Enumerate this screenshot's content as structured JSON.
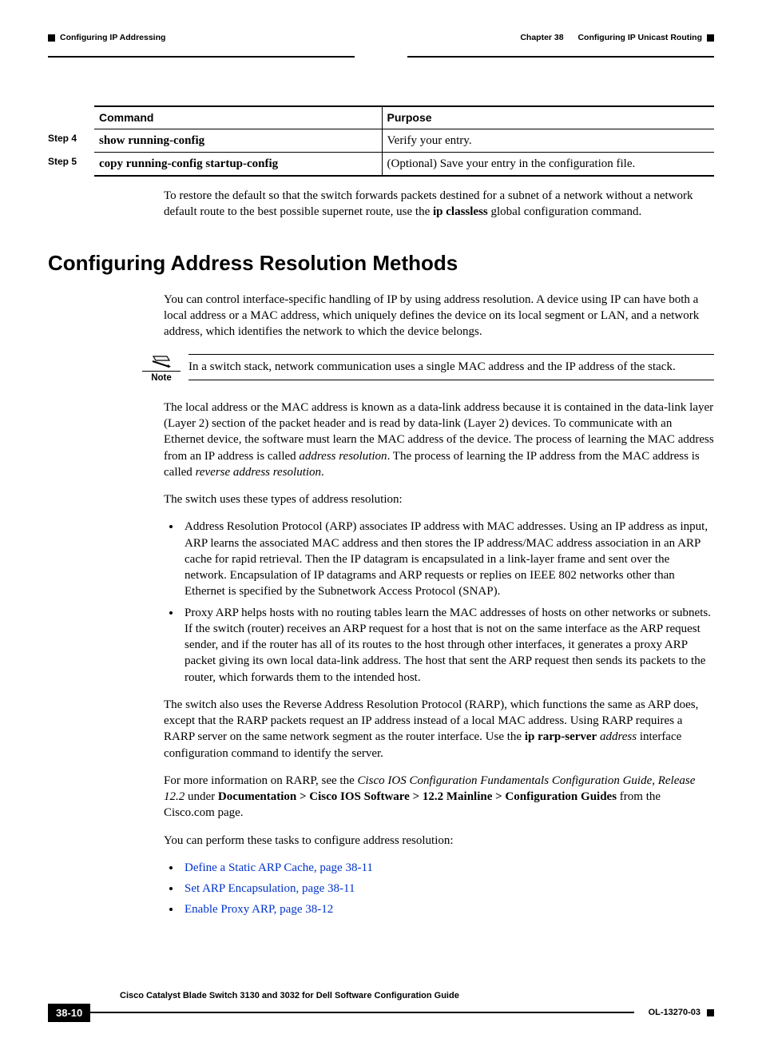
{
  "header": {
    "left": "Configuring IP Addressing",
    "chapter": "Chapter 38",
    "right": "Configuring IP Unicast Routing"
  },
  "table": {
    "head_command": "Command",
    "head_purpose": "Purpose",
    "rows": [
      {
        "step": "Step 4",
        "command": "show running-config",
        "purpose": "Verify your entry."
      },
      {
        "step": "Step 5",
        "command": "copy running-config startup-config",
        "purpose": "(Optional) Save your entry in the configuration file."
      }
    ]
  },
  "p_restore_a": "To restore the default so that the switch forwards packets destined for a subnet of a network without a network default route to the best possible supernet route, use the ",
  "p_restore_b": "ip classless",
  "p_restore_c": " global configuration command.",
  "section_title": "Configuring Address Resolution Methods",
  "p_intro": "You can control interface-specific handling of IP by using address resolution. A device using IP can have both a local address or a MAC address, which uniquely defines the device on its local segment or LAN, and a network address, which identifies the network to which the device belongs.",
  "note_label": "Note",
  "note_text": "In a switch stack, network communication uses a single MAC address and the IP address of the stack.",
  "p_local_a": "The local address or the MAC address is known as a data-link address because it is contained in the data-link layer (Layer 2) section of the packet header and is read by data-link (Layer 2) devices. To communicate with an Ethernet device, the software must learn the MAC address of the device. The process of learning the MAC address from an IP address is called ",
  "p_local_b": "address resolution",
  "p_local_c": ". The process of learning the IP address from the MAC address is called ",
  "p_local_d": "reverse address resolution",
  "p_local_e": ".",
  "p_types": "The switch uses these types of address resolution:",
  "bul1": "Address Resolution Protocol (ARP) associates IP address with MAC addresses. Using an IP address as input, ARP learns the associated MAC address and then stores the IP address/MAC address association in an ARP cache for rapid retrieval. Then the IP datagram is encapsulated in a link-layer frame and sent over the network. Encapsulation of IP datagrams and ARP requests or replies on IEEE 802 networks other than Ethernet is specified by the Subnetwork Access Protocol (SNAP).",
  "bul2": "Proxy ARP helps hosts with no routing tables learn the MAC addresses of hosts on other networks or subnets. If the switch (router) receives an ARP request for a host that is not on the same interface as the ARP request sender, and if the router has all of its routes to the host through other interfaces, it generates a proxy ARP packet giving its own local data-link address. The host that sent the ARP request then sends its packets to the router, which forwards them to the intended host.",
  "p_rarp_a": "The switch also uses the Reverse Address Resolution Protocol (RARP), which functions the same as ARP does, except that the RARP packets request an IP address instead of a local MAC address. Using RARP requires a RARP server on the same network segment as the router interface. Use the ",
  "p_rarp_b": "ip rarp-server",
  "p_rarp_c": " ",
  "p_rarp_d": "address",
  "p_rarp_e": " interface configuration command to identify the server.",
  "p_more_a": "For more information on RARP, see the ",
  "p_more_b": "Cisco IOS Configuration Fundamentals Configuration Guide, Release 12.2",
  "p_more_c": " under ",
  "p_more_d": "Documentation > Cisco IOS Software > 12.2 Mainline > Configuration Guides",
  "p_more_e": " from the Cisco.com page.",
  "p_tasks": "You can perform these tasks to configure address resolution:",
  "links": {
    "l1": "Define a Static ARP Cache, page 38-11",
    "l2": "Set ARP Encapsulation, page 38-11",
    "l3": "Enable Proxy ARP, page 38-12"
  },
  "footer": {
    "guide": "Cisco Catalyst Blade Switch 3130 and 3032 for Dell Software Configuration Guide",
    "page": "38-10",
    "doc": "OL-13270-03"
  }
}
